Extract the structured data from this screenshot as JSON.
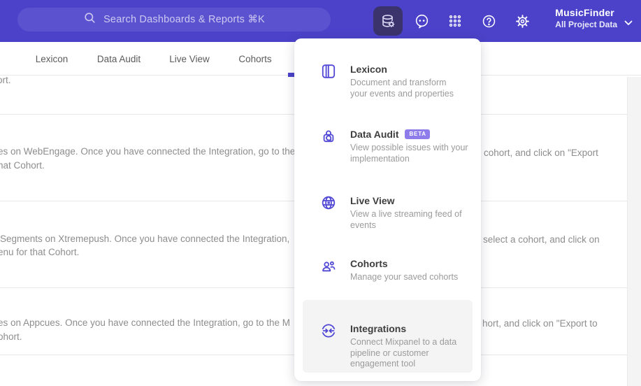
{
  "header": {
    "search_placeholder": "Search Dashboards & Reports ⌘K",
    "project_name": "MusicFinder",
    "project_subtitle": "All Project Data"
  },
  "nav": {
    "tabs": [
      {
        "label": "Lexicon"
      },
      {
        "label": "Data Audit"
      },
      {
        "label": "Live View"
      },
      {
        "label": "Cohorts"
      }
    ]
  },
  "menu": {
    "items": [
      {
        "title": "Lexicon",
        "badge": "",
        "desc": "Document and transform\nyour events and properties",
        "icon": "book-icon"
      },
      {
        "title": "Data Audit",
        "badge": "BETA",
        "desc": "View possible issues with your\nimplementation",
        "icon": "audit-lock-icon"
      },
      {
        "title": "Live View",
        "badge": "",
        "desc": "View a live streaming feed of\nevents",
        "icon": "globe-icon"
      },
      {
        "title": "Cohorts",
        "badge": "",
        "desc": "Manage your saved cohorts",
        "icon": "people-icon"
      },
      {
        "title": "Integrations",
        "badge": "",
        "desc": "Connect Mixpanel to a data\npipeline or customer\nengagement tool",
        "icon": "integration-arrows-icon"
      }
    ]
  },
  "content": {
    "rows": [
      {
        "l1": "ort.",
        "r1": "",
        "l2": ""
      },
      {
        "l1": "es on WebEngage. Once you have connected the Integration, go to the",
        "r1": "cohort, and click on \"Export",
        "l2": "hat Cohort."
      },
      {
        "l1": "Segments on Xtremepush. Once you have connected the Integration,",
        "r1": "select a cohort, and click on",
        "l2": "enu for that Cohort."
      },
      {
        "l1": "es on Appcues. Once you have connected the Integration, go to the M",
        "r1": "hort, and click on \"Export to",
        "l2": "ohort."
      }
    ]
  },
  "colors": {
    "header_bg": "#4b42c9",
    "search_bg": "#5b52d0",
    "active_button_bg": "#3a336c",
    "accent": "#4c42c9",
    "menu_icon": "#5248d6",
    "badge_bg": "#8d7ce9",
    "highlight_bg": "#f4f4f4",
    "body_text": "#8d8d8d"
  }
}
